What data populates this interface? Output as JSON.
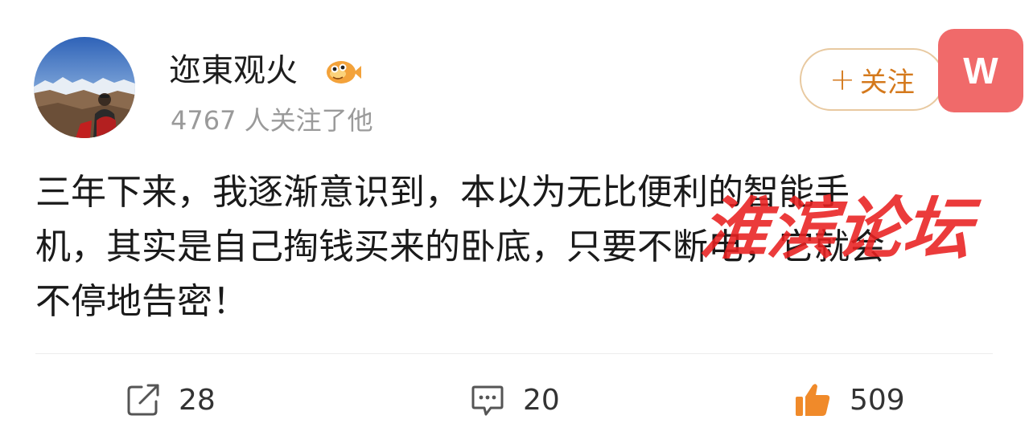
{
  "user": {
    "name": "迩東观火",
    "badge_icon": "fish-icon",
    "follower_text": "4767 人关注了他",
    "avatar_icon": "avatar-photo"
  },
  "follow_button": {
    "label": "关注",
    "plus": "+"
  },
  "floating_button": {
    "label": "W",
    "color": "#f06a6a"
  },
  "post": {
    "lines": [
      "三年下来，我逐渐意识到，本以为无比便利的智能手",
      "机，其实是自己掏钱买来的卧底，只要不断电，它就会",
      "不停地告密！"
    ]
  },
  "watermark": {
    "text": "淮滨论坛",
    "color": "#e82020"
  },
  "actions": {
    "repost": {
      "icon": "repost-icon",
      "count": "28"
    },
    "comment": {
      "icon": "comment-icon",
      "count": "20"
    },
    "like": {
      "icon": "thumbs-up-icon",
      "count": "509",
      "color": "#f08a2a"
    }
  },
  "colors": {
    "follow_accent": "#d4791c",
    "follower_text": "#9a9a9a"
  }
}
